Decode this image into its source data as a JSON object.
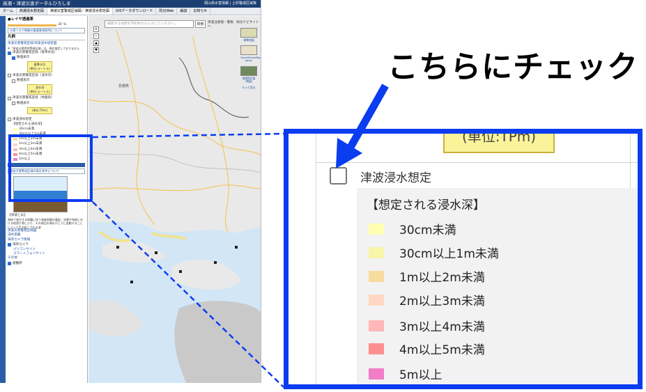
{
  "screenshot": {
    "title": "高潮・津波災害ポータルひろしま",
    "title_right": "岡山県水害情報 | 土砂警戒区域等",
    "tabs": [
      "ホーム",
      "高潮浸水想定図",
      "津波災害警戒区域図／津波浸水想定図",
      "GISデータダウンロード",
      "防災Web",
      "解説",
      "お知らせ"
    ],
    "panel": {
      "layer_opacity_label": "●レイヤ透過率",
      "opacity_value": "30",
      "opacity_unit": "%",
      "risk_info_link": "水害リスク情報の重要事項説明について",
      "legend_heading": "凡例",
      "section_link": "津波災害警戒区域/津波浸水想定図",
      "note": "※「津波災害特別警戒区域」は、現在指定しておりません",
      "layer1": "津波災害警戒区域（基準水位）",
      "layer1_sub": "数値表示",
      "layer1_box_line1": "基準水位",
      "layer1_box_line2": "(単位:メートル)",
      "layer2": "津波災害警戒区域（浸水深）",
      "layer2_sub": "数値表示",
      "layer2_box_line1": "浸水深",
      "layer2_box_line2": "(単位:メートル)",
      "layer3": "津波災害警戒区域（地盤高）",
      "layer3_sub": "数値表示",
      "layer3_box": "(単位:TPm)",
      "tsunami_layer": "津波浸水想定",
      "tsunami_head": "【想定される浸水深】",
      "tsunami_items": [
        "30cm未満",
        "30cm以上1m未満",
        "1m以上2m未満",
        "2m以上3m未満",
        "3m以上4m未満",
        "4m以上5m未満",
        "5m以上"
      ],
      "bar_link": "津波災害警戒区域の表示条件について",
      "about_head": "【津波とは】",
      "about_text": "海底で発生する地震に伴う海底地盤の隆起・沈降や海底における地滑り等により、その周辺の海水が上下に変動することによって引き起こされる波",
      "sub_links": [
        "津波災害警戒区域図",
        "浸水実績"
      ],
      "camera_head": "海岸カメラ情報",
      "camera_item": "海岸カメラ",
      "camera_links": [
        "パソコンサイト",
        "スマートフォンサイト"
      ],
      "other_head": "その他",
      "other_item": "避難所"
    },
    "map": {
      "search_placeholder": "検索する住所を市町村から入力してください。",
      "search_button": "検索",
      "links": "津波注意報・警報　防災ナビサイトへ",
      "pref_label": "島根県",
      "thumb_labels": [
        "標準地図",
        "OpenStreetMap Japan",
        "地理院写真(地図)",
        "もっと見る"
      ]
    }
  },
  "callout": {
    "text": "こちらにチェック"
  },
  "zoom": {
    "unit_box": "(単位:TPm)",
    "layer_title": "津波浸水想定",
    "legend_head": "【想定される浸水深】",
    "items": [
      "30cm未満",
      "30cm以上1m未満",
      "1m以上2m未満",
      "2m以上3m未満",
      "3m以上4m未満",
      "4m以上5m未満",
      "5m以上"
    ],
    "colors": [
      "#ffffb3",
      "#f7f5a8",
      "#f8dc9f",
      "#ffd7c2",
      "#ffb7b7",
      "#ff8f8f",
      "#f17dc8"
    ]
  },
  "accent_color": "#0a3cf0"
}
